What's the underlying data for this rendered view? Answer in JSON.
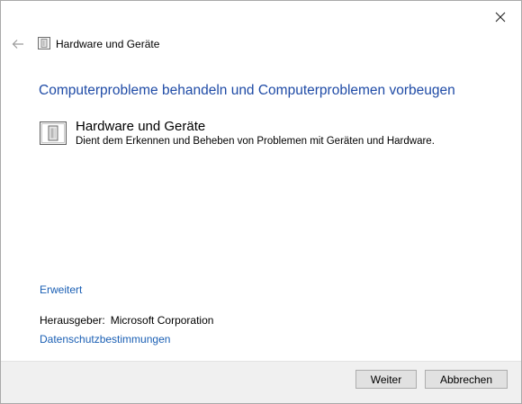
{
  "window": {
    "title": "Hardware und Geräte"
  },
  "main": {
    "heading": "Computerprobleme behandeln und Computerproblemen vorbeugen",
    "item": {
      "title": "Hardware und Geräte",
      "description": "Dient dem Erkennen und Beheben von Problemen mit Geräten und Hardware."
    },
    "advanced_link": "Erweitert",
    "publisher_label": "Herausgeber:",
    "publisher_value": "Microsoft Corporation",
    "privacy_link": "Datenschutzbestimmungen"
  },
  "footer": {
    "next_label": "Weiter",
    "cancel_label": "Abbrechen"
  },
  "icons": {
    "close": "close-icon",
    "back": "back-arrow-icon",
    "hardware": "hardware-device-icon"
  },
  "colors": {
    "heading": "#1f4ba6",
    "link": "#1a5fb4",
    "footer_bg": "#f0f0f0"
  }
}
